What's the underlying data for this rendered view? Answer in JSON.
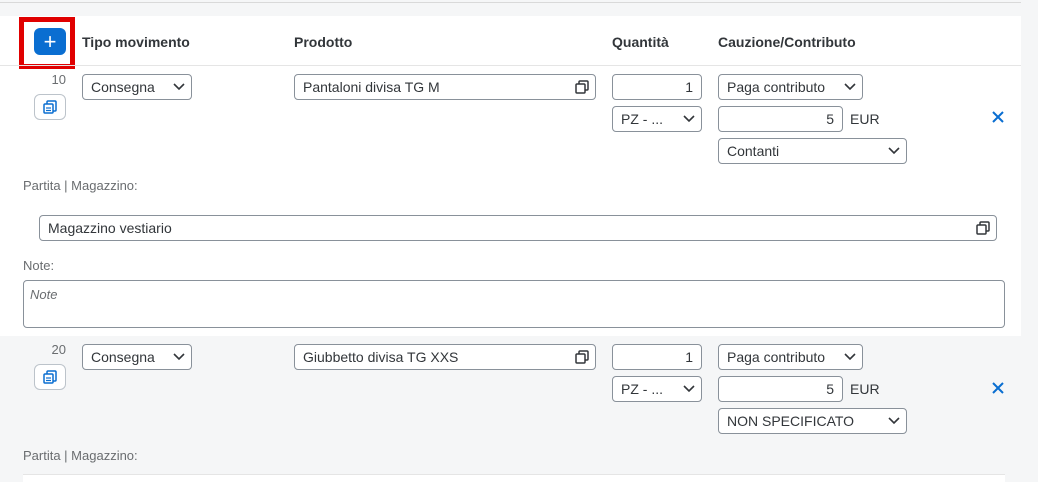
{
  "toolbar": {
    "add_label": "+"
  },
  "columns": {
    "tipo": "Tipo movimento",
    "prodotto": "Prodotto",
    "quantita": "Quantità",
    "cauzione": "Cauzione/Contributo"
  },
  "items": [
    {
      "number": "10",
      "tipo": "Consegna",
      "prodotto": "Pantaloni divisa TG M",
      "quantita": "1",
      "unita": "PZ - ...",
      "cauzione_tipo": "Paga contributo",
      "importo": "5",
      "valuta": "EUR",
      "pagamento": "Contanti",
      "partita_label": "Partita | Magazzino:",
      "magazzino": "Magazzino vestiario",
      "note_label": "Note:",
      "note_placeholder": "Note"
    },
    {
      "number": "20",
      "tipo": "Consegna",
      "prodotto": "Giubbetto divisa TG XXS",
      "quantita": "1",
      "unita": "PZ - ...",
      "cauzione_tipo": "Paga contributo",
      "importo": "5",
      "valuta": "EUR",
      "pagamento": "NON SPECIFICATO",
      "partita_label": "Partita | Magazzino:"
    }
  ],
  "colors": {
    "accent": "#0a6ed1",
    "highlight": "#e00000"
  },
  "icons": [
    "plus-icon",
    "copy-icon",
    "value-help-icon",
    "chevron-down-icon",
    "close-icon"
  ]
}
